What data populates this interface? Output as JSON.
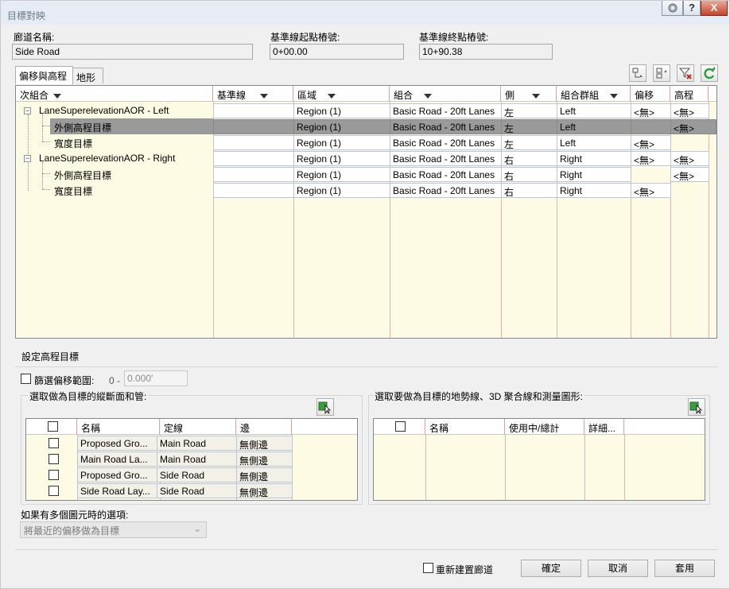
{
  "window": {
    "title": "目標對映",
    "help_label": "?",
    "close_label": "X"
  },
  "fields": {
    "corridor_name": {
      "label": "廊道名稱:",
      "value": "Side Road"
    },
    "start_station": {
      "label": "基準線起點樁號:",
      "value": "0+00.00"
    },
    "end_station": {
      "label": "基準線終點樁號:",
      "value": "10+90.38"
    }
  },
  "tabs": [
    {
      "label": "偏移與高程"
    },
    {
      "label": "地形"
    }
  ],
  "grid": {
    "columns": [
      "次組合",
      "基準線",
      "區域",
      "組合",
      "側",
      "組合群組",
      "偏移",
      "高程"
    ],
    "groups": [
      {
        "name": "LaneSuperelevationAOR - Left",
        "region": "Region (1)",
        "assembly": "Basic Road - 20ft Lanes",
        "side": "左",
        "group": "Left",
        "offset": "<無>",
        "elevation": "<無>",
        "children": [
          {
            "name": "外側高程目標",
            "region": "Region (1)",
            "assembly": "Basic Road - 20ft Lanes",
            "side": "左",
            "group": "Left",
            "offset": "",
            "elevation": "<無>",
            "selected": true
          },
          {
            "name": "寬度目標",
            "region": "Region (1)",
            "assembly": "Basic Road - 20ft Lanes",
            "side": "左",
            "group": "Left",
            "offset": "<無>",
            "elevation": ""
          }
        ]
      },
      {
        "name": "LaneSuperelevationAOR - Right",
        "region": "Region (1)",
        "assembly": "Basic Road - 20ft Lanes",
        "side": "右",
        "group": "Right",
        "offset": "<無>",
        "elevation": "<無>",
        "children": [
          {
            "name": "外側高程目標",
            "region": "Region (1)",
            "assembly": "Basic Road - 20ft Lanes",
            "side": "右",
            "group": "Right",
            "offset": "",
            "elevation": "<無>"
          },
          {
            "name": "寬度目標",
            "region": "Region (1)",
            "assembly": "Basic Road - 20ft Lanes",
            "side": "右",
            "group": "Right",
            "offset": "<無>",
            "elevation": ""
          }
        ]
      }
    ]
  },
  "elevation_targets": {
    "title": "設定高程目標",
    "filter_label": "篩選偏移範圍:",
    "filter_from": "0 -",
    "filter_value": "0.000'",
    "profiles_title": "選取做為目標的縱斷面和管:",
    "profiles_columns": [
      "名稱",
      "定線",
      "邊"
    ],
    "profiles": [
      {
        "name": "Proposed Gro...",
        "alignment": "Main Road",
        "side": "無側邊"
      },
      {
        "name": "Main Road La...",
        "alignment": "Main Road",
        "side": "無側邊"
      },
      {
        "name": "Proposed Gro...",
        "alignment": "Side Road",
        "side": "無側邊"
      },
      {
        "name": "Side Road Lay...",
        "alignment": "Side Road",
        "side": "無側邊"
      }
    ],
    "features_title": "選取要做為目標的地勢線、3D 聚合線和測量圖形:",
    "features_columns": [
      "名稱",
      "使用中/總計",
      "詳細..."
    ],
    "multi_label": "如果有多個圖元時的選項:",
    "multi_value": "將最近的偏移做為目標"
  },
  "footer": {
    "rebuild_label": "重新建置廊道",
    "ok_label": "確定",
    "cancel_label": "取消",
    "apply_label": "套用"
  }
}
